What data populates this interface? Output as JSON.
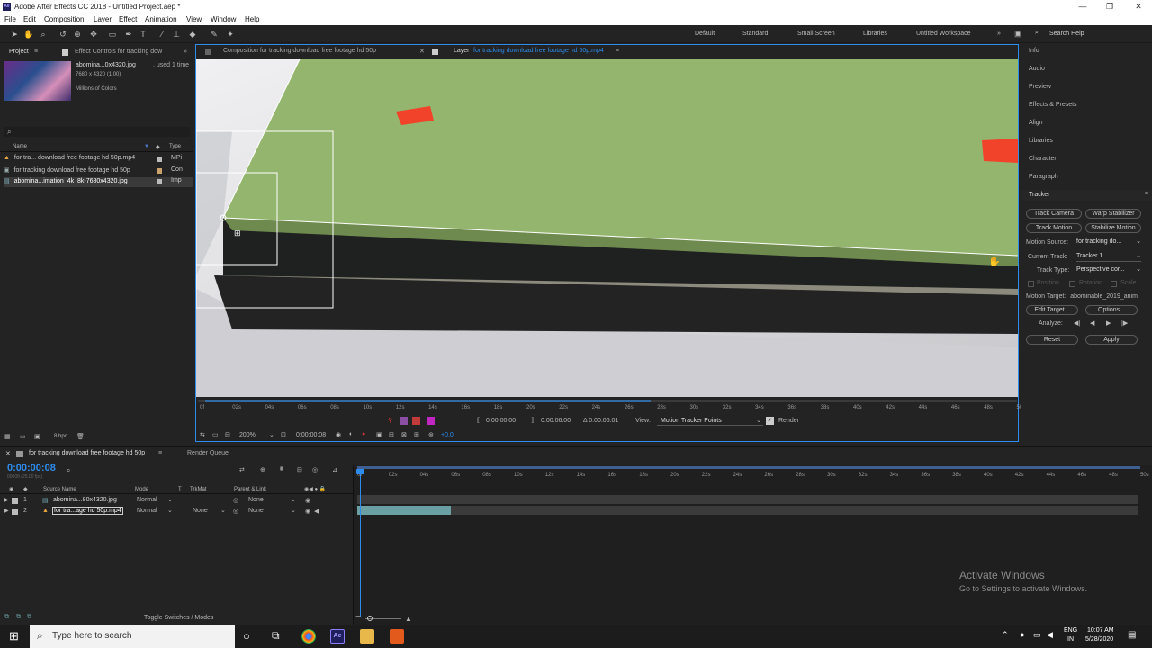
{
  "window": {
    "title": "Adobe After Effects CC 2018 - Untitled Project.aep *"
  },
  "menu": [
    "File",
    "Edit",
    "Composition",
    "Layer",
    "Effect",
    "Animation",
    "View",
    "Window",
    "Help"
  ],
  "workspaces": [
    "Default",
    "Standard",
    "Small Screen",
    "Libraries",
    "Untitled Workspace"
  ],
  "search_help": "Search Help",
  "project": {
    "tab": "Project",
    "effect_tab": "Effect Controls for tracking dow",
    "thumb_name": "abomina...0x4320.jpg",
    "thumb_used": ", used 1 time",
    "thumb_dims": "7680 x 4320 (1.00)",
    "thumb_colors": "Millions of Colors",
    "col_name": "Name",
    "col_type": "Type",
    "items": [
      {
        "name": "for tra... download free footage hd 50p.mp4",
        "type": "MPi"
      },
      {
        "name": "for tracking download free footage hd 50p",
        "type": "Con"
      },
      {
        "name": "abomina...imation_4k_8k-7680x4320.jpg",
        "type": "Imp"
      }
    ],
    "bpc": "8 bpc"
  },
  "viewer": {
    "tab_comp": "Composition for tracking download free footage hd 50p",
    "tab_layer_prefix": "Layer",
    "tab_layer": "for tracking download free footage hd 50p.mp4",
    "ruler": [
      "0f",
      "02s",
      "04s",
      "06s",
      "08s",
      "10s",
      "12s",
      "14s",
      "16s",
      "18s",
      "20s",
      "22s",
      "24s",
      "26s",
      "28s",
      "30s",
      "32s",
      "34s",
      "36s",
      "38s",
      "40s",
      "42s",
      "44s",
      "46s",
      "48s",
      "50s"
    ],
    "time_in": "0:00:00:00",
    "time_out": "0:00:06:00",
    "time_delta": "Δ 0:00:06:01",
    "view_label": "View:",
    "view_value": "Motion Tracker Points",
    "render_label": "Render",
    "zoom": "200%",
    "current_time": "0:00:00:08",
    "exposure": "+0.0"
  },
  "right_panels": [
    "Info",
    "Audio",
    "Preview",
    "Effects & Presets",
    "Align",
    "Libraries",
    "Character",
    "Paragraph"
  ],
  "tracker": {
    "title": "Tracker",
    "track_camera": "Track Camera",
    "warp_stabilizer": "Warp Stabilizer",
    "track_motion": "Track Motion",
    "stabilize_motion": "Stabilize Motion",
    "motion_source_label": "Motion Source:",
    "motion_source": "for tracking do...",
    "current_track_label": "Current Track:",
    "current_track": "Tracker 1",
    "track_type_label": "Track Type:",
    "track_type": "Perspective cor...",
    "position": "Position",
    "rotation": "Rotation",
    "scale": "Scale",
    "motion_target_label": "Motion Target:",
    "motion_target": "abominable_2019_anim",
    "edit_target": "Edit Target...",
    "options": "Options...",
    "analyze": "Analyze:",
    "reset": "Reset",
    "apply": "Apply"
  },
  "timeline": {
    "tab": "for tracking download free footage hd 50p",
    "render_queue": "Render Queue",
    "timecode": "0:00:00:08",
    "timecode_sub": "00008 (25.00 fps)",
    "cols": {
      "source": "Source Name",
      "mode": "Mode",
      "t": "T",
      "trkmat": "TrkMat",
      "parent": "Parent & Link"
    },
    "layers": [
      {
        "num": "1",
        "name": "abomina...80x4320.jpg",
        "mode": "Normal",
        "trkmat": "",
        "parent": "None"
      },
      {
        "num": "2",
        "name": "for tra...age hd 50p.mp4",
        "mode": "Normal",
        "trkmat": "None",
        "parent": "None"
      }
    ],
    "ruler": [
      "0f",
      "02s",
      "04s",
      "06s",
      "08s",
      "10s",
      "12s",
      "14s",
      "16s",
      "18s",
      "20s",
      "22s",
      "24s",
      "26s",
      "28s",
      "30s",
      "32s",
      "34s",
      "36s",
      "38s",
      "40s",
      "42s",
      "44s",
      "46s",
      "48s",
      "50s"
    ],
    "toggle": "Toggle Switches / Modes"
  },
  "watermark": {
    "line1": "Activate Windows",
    "line2": "Go to Settings to activate Windows."
  },
  "taskbar": {
    "search_placeholder": "Type here to search",
    "lang": "ENG",
    "region": "IN",
    "time": "10:07 AM",
    "date": "5/28/2020"
  },
  "colors": {
    "accent": "#2d8ceb",
    "track_point": "#ffffff",
    "layer_bar": "#6a9fa3"
  }
}
